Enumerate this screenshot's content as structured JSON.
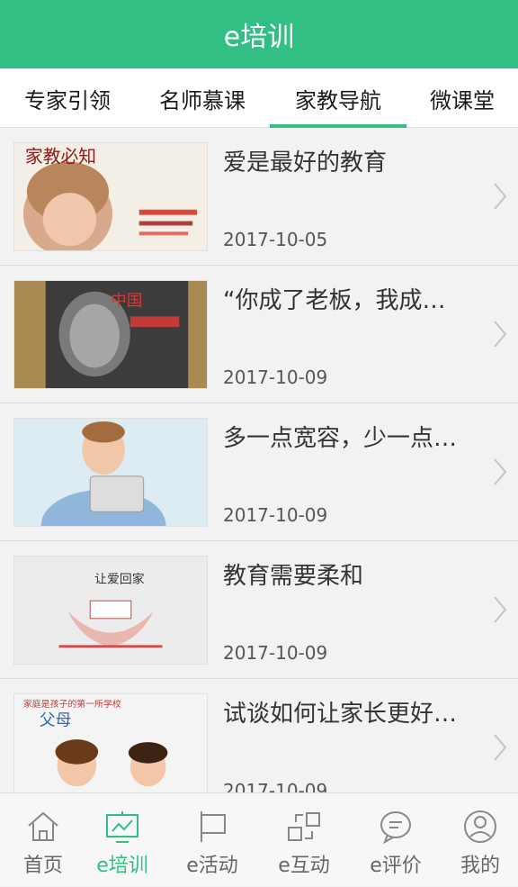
{
  "header": {
    "title": "e培训"
  },
  "tabs": [
    {
      "label": "专家引领"
    },
    {
      "label": "名师慕课"
    },
    {
      "label": "家教导航",
      "active": true
    },
    {
      "label": "微课堂"
    }
  ],
  "articles": [
    {
      "title": "爱是最好的教育",
      "date": "2017-10-05",
      "thumb_text": "家教必知"
    },
    {
      "title": "“你成了老板，我成…",
      "date": "2017-10-09",
      "thumb_text": "中国"
    },
    {
      "title": "多一点宽容，少一点…",
      "date": "2017-10-09",
      "thumb_text": ""
    },
    {
      "title": "教育需要柔和",
      "date": "2017-10-09",
      "thumb_text": "让爱回家"
    },
    {
      "title": "试谈如何让家长更好…",
      "date": "2017-10-09",
      "thumb_text": "家庭是孩子的第一所学校"
    }
  ],
  "bottom_nav": [
    {
      "label": "首页",
      "icon": "home-icon"
    },
    {
      "label": "e培训",
      "icon": "training-icon",
      "active": true
    },
    {
      "label": "e活动",
      "icon": "flag-icon"
    },
    {
      "label": "e互动",
      "icon": "interact-icon"
    },
    {
      "label": "e评价",
      "icon": "comment-icon"
    },
    {
      "label": "我的",
      "icon": "user-icon"
    }
  ],
  "colors": {
    "accent": "#31bf84"
  }
}
